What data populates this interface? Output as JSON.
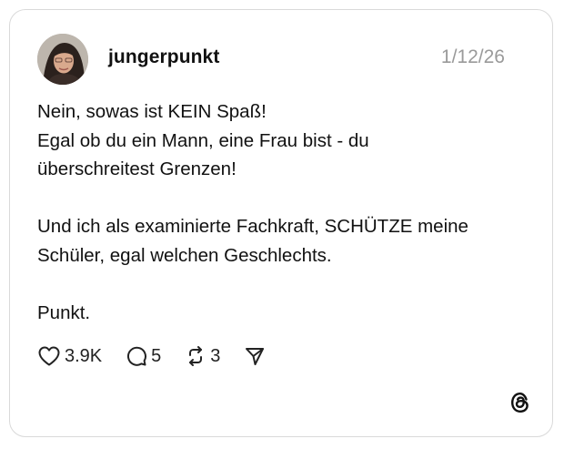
{
  "post": {
    "username": "jungerpunkt",
    "date": "1/12/26",
    "lines": [
      "Nein, sowas ist KEIN Spaß!",
      "Egal ob du ein Mann, eine Frau bist - du",
      "überschreitest Grenzen!",
      "",
      "Und ich als examinierte Fachkraft, SCHÜTZE meine",
      "Schüler, egal welchen Geschlechts.",
      "",
      "Punkt."
    ]
  },
  "actions": {
    "likes": "3.9K",
    "comments": "5",
    "reposts": "3"
  },
  "icons": {
    "like": "heart-icon",
    "comment": "comment-icon",
    "repost": "repost-icon",
    "share": "send-icon",
    "brand": "threads-logo-icon"
  },
  "colors": {
    "text": "#111111",
    "muted": "#9a9a9a",
    "border": "#d9d9d9"
  }
}
